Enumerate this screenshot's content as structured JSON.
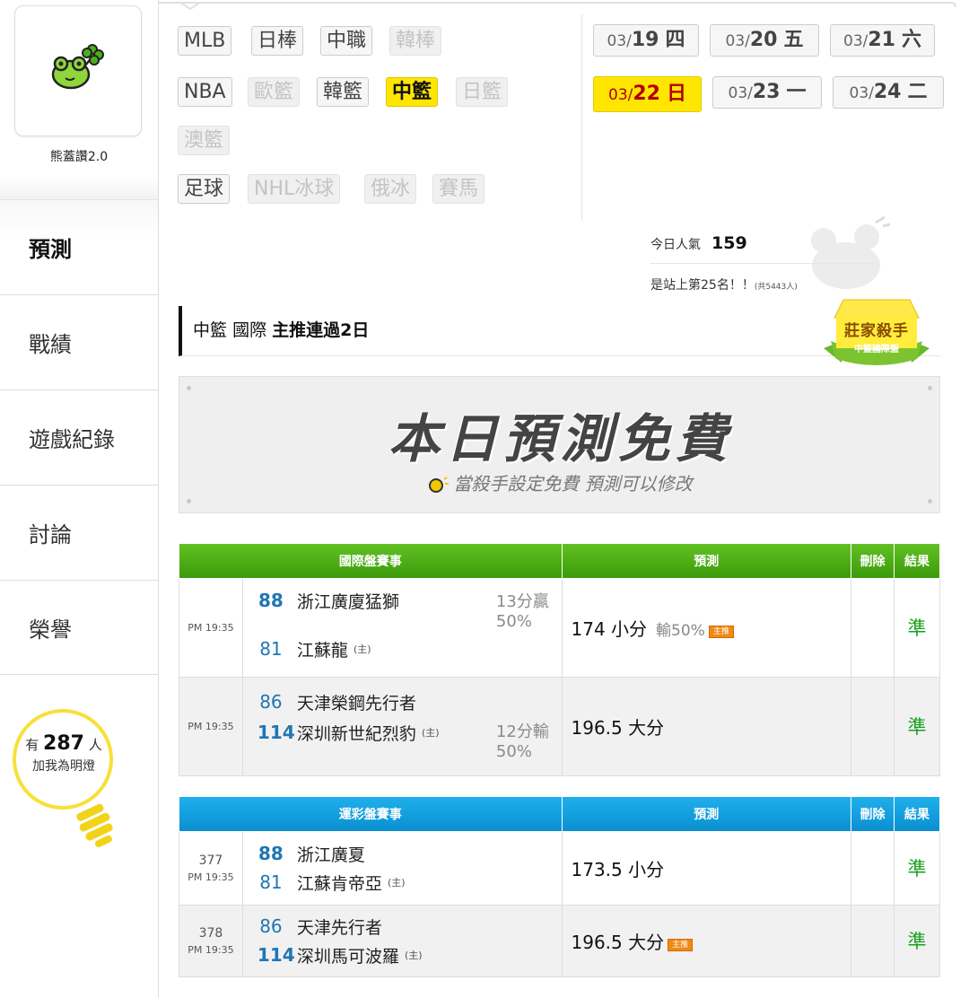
{
  "sidebar": {
    "profile_name": "熊蓋讚2.0",
    "nav": [
      {
        "label": "預測",
        "active": true
      },
      {
        "label": "戰績"
      },
      {
        "label": "遊戲紀錄"
      },
      {
        "label": "討論"
      },
      {
        "label": "榮譽"
      }
    ],
    "fans": {
      "prefix": "有",
      "count": "287",
      "suffix": "人",
      "line2": "加我為明燈"
    }
  },
  "sports": [
    {
      "label": "MLB",
      "state": "normal"
    },
    {
      "label": "日棒",
      "state": "normal"
    },
    {
      "label": "中職",
      "state": "normal"
    },
    {
      "label": "韓棒",
      "state": "dim"
    },
    {
      "label": "NBA",
      "state": "normal"
    },
    {
      "label": "歐籃",
      "state": "dim"
    },
    {
      "label": "韓籃",
      "state": "normal"
    },
    {
      "label": "中籃",
      "state": "selected"
    },
    {
      "label": "日籃",
      "state": "dim"
    },
    {
      "label": "澳籃",
      "state": "dim"
    },
    {
      "label": "足球",
      "state": "normal"
    },
    {
      "label": "NHL冰球",
      "state": "dim"
    },
    {
      "label": "俄冰",
      "state": "dim"
    },
    {
      "label": "賽馬",
      "state": "dim"
    }
  ],
  "dates": [
    {
      "md": "03/",
      "day": "19",
      "wd": "四"
    },
    {
      "md": "03/",
      "day": "20",
      "wd": "五"
    },
    {
      "md": "03/",
      "day": "21",
      "wd": "六"
    },
    {
      "md": "03/",
      "day": "22",
      "wd": "日",
      "selected": true
    },
    {
      "md": "03/",
      "day": "23",
      "wd": "一"
    },
    {
      "md": "03/",
      "day": "24",
      "wd": "二"
    }
  ],
  "stats": {
    "popularity_label": "今日人氣",
    "popularity_value": "159",
    "rank_text": "是站上第25名！！",
    "rank_total": "(共5443人)"
  },
  "headline": {
    "league": "中籃",
    "type": "國際",
    "streak": "主推連過2日"
  },
  "badge": {
    "title": "莊家殺手",
    "subtitle": "中籃國際盤"
  },
  "banner": {
    "title": "本日預測免費",
    "subtitle": "當殺手設定免費 預測可以修改"
  },
  "intl_table": {
    "headers": [
      "國際盤賽事",
      "預測",
      "刪除",
      "結果"
    ],
    "rows": [
      {
        "time": "PM 19:35",
        "away_score": "88",
        "away_team": "浙江廣廈猛獅",
        "home_score": "81",
        "home_team": "江蘇龍",
        "host": "(主)",
        "odds_line1": "13分贏",
        "odds_line2": "50%",
        "odds_pos": "top",
        "prediction": "174 小分",
        "pred_extra": "輸50%",
        "main_pick": "主推",
        "result": "準"
      },
      {
        "time": "PM 19:35",
        "away_score": "86",
        "away_team": "天津榮鋼先行者",
        "home_score": "114",
        "home_team": "深圳新世紀烈豹",
        "host": "(主)",
        "odds_line1": "12分輸",
        "odds_line2": "50%",
        "odds_pos": "bottom",
        "prediction": "196.5 大分",
        "result": "準"
      }
    ]
  },
  "lottery_table": {
    "headers": [
      "運彩盤賽事",
      "預測",
      "刪除",
      "結果"
    ],
    "rows": [
      {
        "no": "377",
        "time": "PM 19:35",
        "away_score": "88",
        "away_team": "浙江廣夏",
        "home_score": "81",
        "home_team": "江蘇肯帝亞",
        "host": "(主)",
        "prediction": "173.5 小分",
        "result": "準"
      },
      {
        "no": "378",
        "time": "PM 19:35",
        "away_score": "86",
        "away_team": "天津先行者",
        "home_score": "114",
        "home_team": "深圳馬可波羅",
        "host": "(主)",
        "prediction": "196.5 大分",
        "main_pick": "主推",
        "result": "準"
      }
    ]
  },
  "colors": {
    "accent_yellow": "#ffe600",
    "green_header": "#4aab14",
    "blue_header": "#12a0e0",
    "result_green": "#17a11e",
    "score_blue": "#1f76b4"
  }
}
